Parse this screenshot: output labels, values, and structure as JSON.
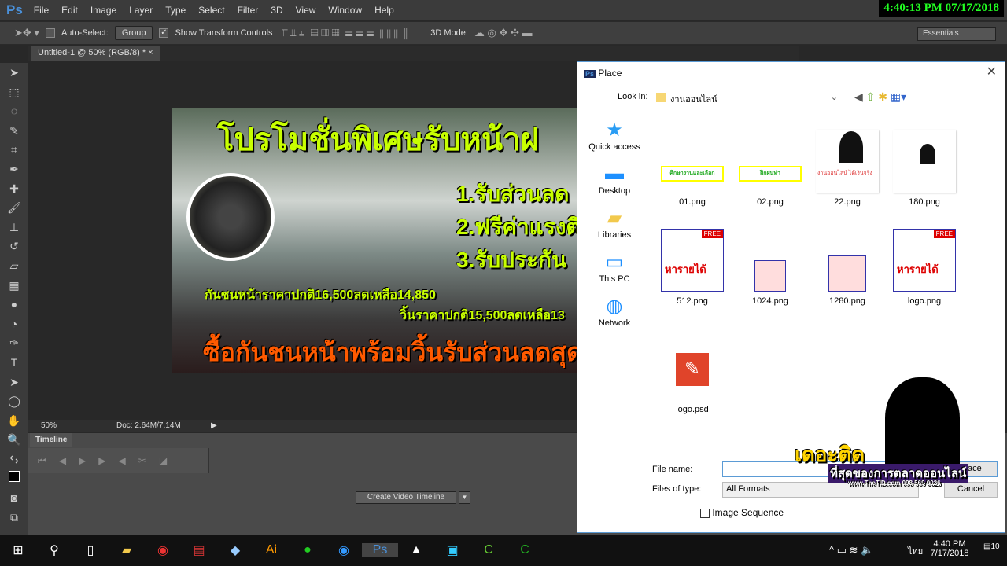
{
  "app": {
    "logo": "Ps",
    "menu": [
      "File",
      "Edit",
      "Image",
      "Layer",
      "Type",
      "Select",
      "Filter",
      "3D",
      "View",
      "Window",
      "Help"
    ],
    "clock": "4:40:13 PM 07/17/2018"
  },
  "options": {
    "auto_select": "Auto-Select:",
    "group": "Group",
    "show_transform": "Show Transform Controls",
    "mode3d": "3D Mode:",
    "workspace": "Essentials"
  },
  "document": {
    "tab": "Untitled-1 @ 50% (RGB/8) *",
    "zoom": "50%",
    "doc_size": "Doc: 2.64M/7.14M"
  },
  "artwork": {
    "headline": "โปรโมชั่นพิเศษรับหน้าฝ",
    "item1": "1.รับส่วนลด",
    "item2": "2.ฟรีค่าแรงติ",
    "item3": "3.รับประกัน",
    "price1": "กันชนหน้าราคาปกติ16,500ลดเหลือ14,850",
    "price2": "วิ้นราคาปกติ15,500ลดเหลือ13",
    "footer": "ซื้อกันชนหน้าพร้อมวิ้นรับส่วนลดสุด"
  },
  "timeline": {
    "tab": "Timeline",
    "create_button": "Create Video Timeline"
  },
  "dialog": {
    "title": "Place",
    "look_in_label": "Look in:",
    "look_in_value": "งานออนไลน์",
    "places": [
      {
        "label": "Quick access",
        "icon": "star"
      },
      {
        "label": "Desktop",
        "icon": "desktop"
      },
      {
        "label": "Libraries",
        "icon": "folder"
      },
      {
        "label": "This PC",
        "icon": "computer"
      },
      {
        "label": "Network",
        "icon": "network"
      }
    ],
    "files": [
      {
        "name": "01.png"
      },
      {
        "name": "02.png"
      },
      {
        "name": "22.png"
      },
      {
        "name": "180.png"
      },
      {
        "name": "512.png"
      },
      {
        "name": "1024.png"
      },
      {
        "name": "1280.png"
      },
      {
        "name": "logo.png"
      },
      {
        "name": "logo.psd"
      }
    ],
    "thumb_text": {
      "t01": "ศึกษางานและเลือก",
      "t02": "ฝึกฝนทำ",
      "t22": "งานออนไลน์ ได้เงินจริง",
      "logo": "หารายได้",
      "free": "FREE"
    },
    "file_name_label": "File name:",
    "file_name_value": "",
    "files_of_type_label": "Files of type:",
    "files_of_type_value": "All Formats",
    "open_button": "Place",
    "cancel_button": "Cancel",
    "image_sequence": "Image Sequence"
  },
  "watermark": {
    "brand": "เดอะติด",
    "tagline": "ที่สุดของการตลาดออนไลน์",
    "site": "www.TheTID.com 098 569 0026"
  },
  "taskbar": {
    "time": "4:40 PM",
    "date": "7/17/2018",
    "lang": "ไทย",
    "notifications": "10"
  }
}
